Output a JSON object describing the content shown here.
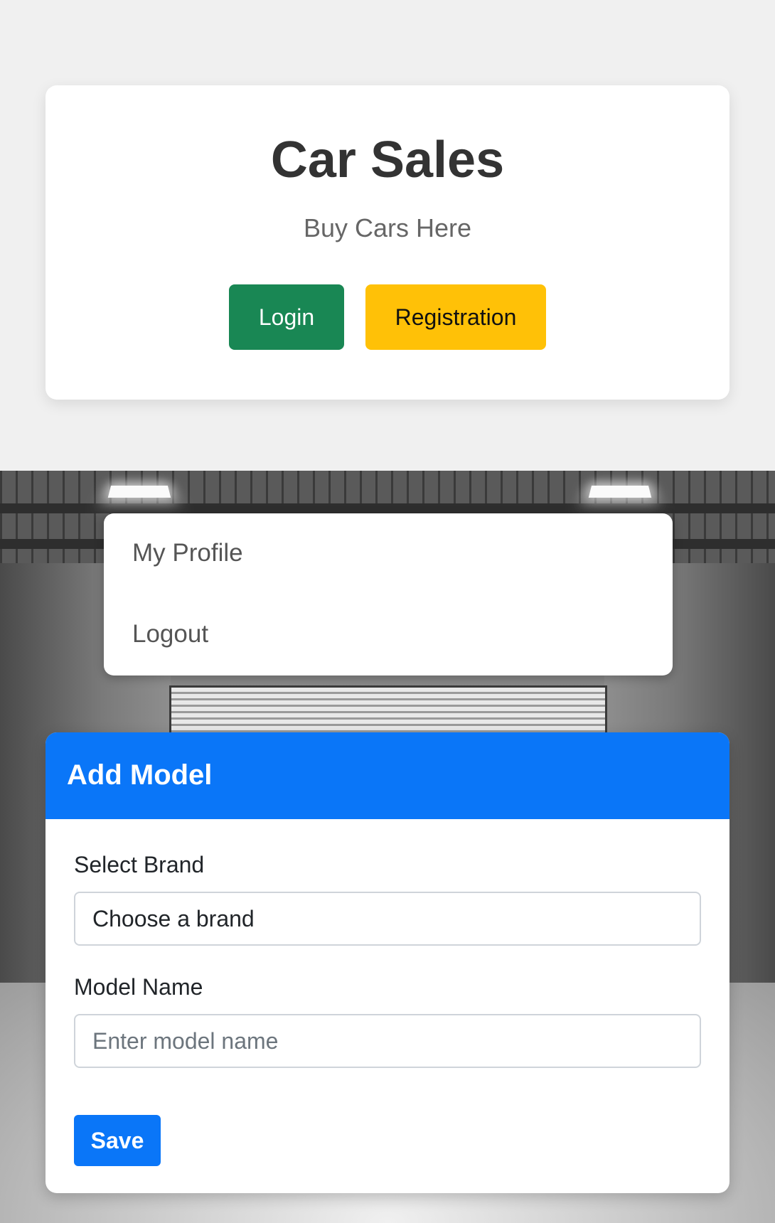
{
  "hero": {
    "title": "Car Sales",
    "subtitle": "Buy Cars Here",
    "login_label": "Login",
    "registration_label": "Registration"
  },
  "user_menu": {
    "items": [
      {
        "label": "My Profile"
      },
      {
        "label": "Logout"
      }
    ]
  },
  "add_model": {
    "title": "Add Model",
    "brand_label": "Select Brand",
    "brand_selected": "Choose a brand",
    "model_name_label": "Model Name",
    "model_name_value": "",
    "model_name_placeholder": "Enter model name",
    "save_label": "Save"
  },
  "colors": {
    "login_button": "#198754",
    "registration_button": "#ffc107",
    "primary": "#0a76f8"
  }
}
